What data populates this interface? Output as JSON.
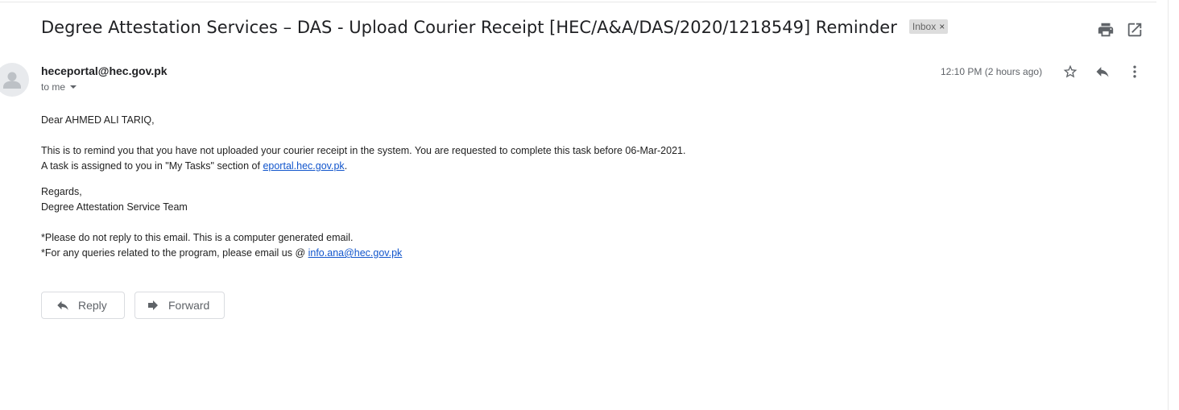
{
  "email": {
    "subject": "Degree Attestation Services – DAS - Upload Courier Receipt [HEC/A&A/DAS/2020/1218549] Reminder",
    "label": "Inbox",
    "label_close": "×",
    "sender": "heceportal@hec.gov.pk",
    "to": "to me",
    "time": "12:10 PM (2 hours ago)",
    "body": {
      "greeting": "Dear AHMED ALI TARIQ,",
      "line1": "This is to remind you that you have not uploaded your courier receipt in the system. You are requested to complete this task before 06-Mar-2021.",
      "line2_prefix": "A task is assigned to you in \"My Tasks\" section of ",
      "line2_link": "eportal.hec.gov.pk",
      "line2_suffix": ".",
      "regards": "Regards,",
      "team": "Degree Attestation Service Team",
      "note1": "*Please do not reply to this email. This is a computer generated email.",
      "note2_prefix": "*For any queries related to the program, please email us @ ",
      "note2_link": "info.ana@hec.gov.pk"
    }
  },
  "actions": {
    "reply": "Reply",
    "forward": "Forward"
  },
  "icons": {
    "print": "print-icon",
    "new_window": "open-in-new-window-icon",
    "star": "star-icon",
    "reply": "reply-icon",
    "more": "more-vertical-icon"
  },
  "colors": {
    "link": "#1155cc",
    "label_bg": "#dddddd",
    "icon": "#5f6368"
  }
}
